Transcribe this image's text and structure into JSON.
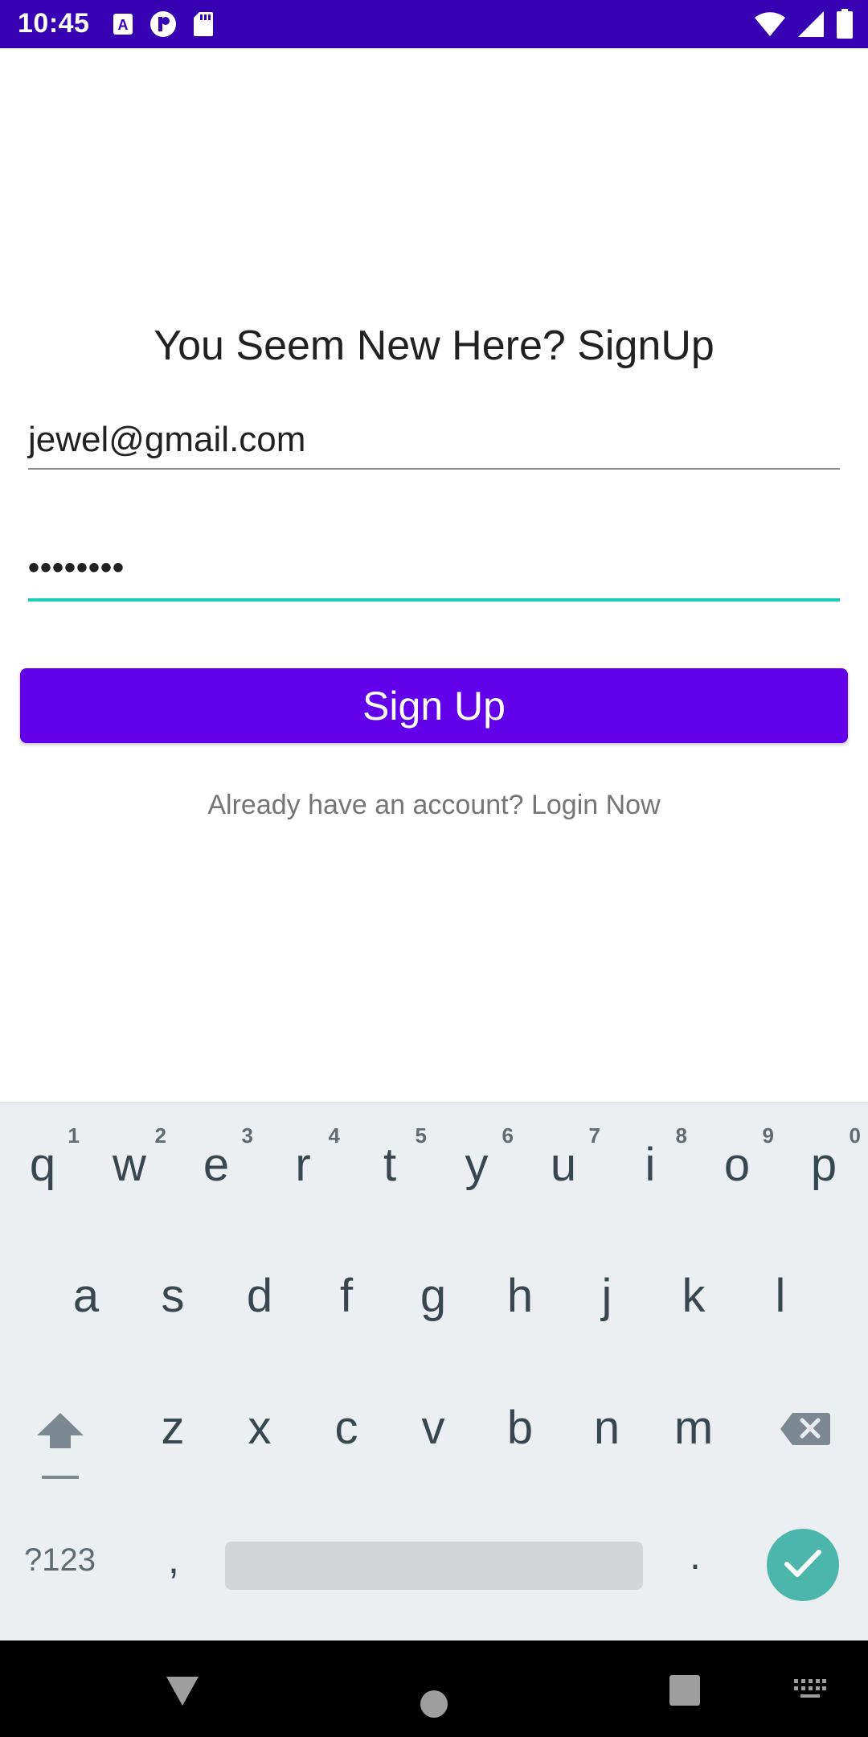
{
  "status_bar": {
    "time": "10:45",
    "icons_left": [
      "font-a-icon",
      "p-circle-icon",
      "sd-card-icon"
    ],
    "icons_right": [
      "wifi-icon",
      "signal-icon",
      "battery-icon"
    ],
    "color": "#3700b3"
  },
  "signup": {
    "title": "You Seem New Here? SignUp",
    "email_value": "jewel@gmail.com",
    "password_value": "••••••••",
    "button_label": "Sign Up",
    "login_link": "Already have an account? Login Now",
    "accent_color": "#6200ea",
    "focus_color": "#1ecdb6"
  },
  "keyboard": {
    "row1": [
      {
        "key": "q",
        "hint": "1"
      },
      {
        "key": "w",
        "hint": "2"
      },
      {
        "key": "e",
        "hint": "3"
      },
      {
        "key": "r",
        "hint": "4"
      },
      {
        "key": "t",
        "hint": "5"
      },
      {
        "key": "y",
        "hint": "6"
      },
      {
        "key": "u",
        "hint": "7"
      },
      {
        "key": "i",
        "hint": "8"
      },
      {
        "key": "o",
        "hint": "9"
      },
      {
        "key": "p",
        "hint": "0"
      }
    ],
    "row2": [
      "a",
      "s",
      "d",
      "f",
      "g",
      "h",
      "j",
      "k",
      "l"
    ],
    "row3": [
      "z",
      "x",
      "c",
      "v",
      "b",
      "n",
      "m"
    ],
    "symbols_label": "?123",
    "comma_label": ",",
    "period_label": ".",
    "enter_icon": "check-icon",
    "shift_icon": "shift-icon",
    "backspace_icon": "backspace-icon"
  },
  "nav_bar": {
    "icons": [
      "back-triangle-icon",
      "home-circle-icon",
      "recents-square-icon",
      "keyboard-icon"
    ]
  }
}
